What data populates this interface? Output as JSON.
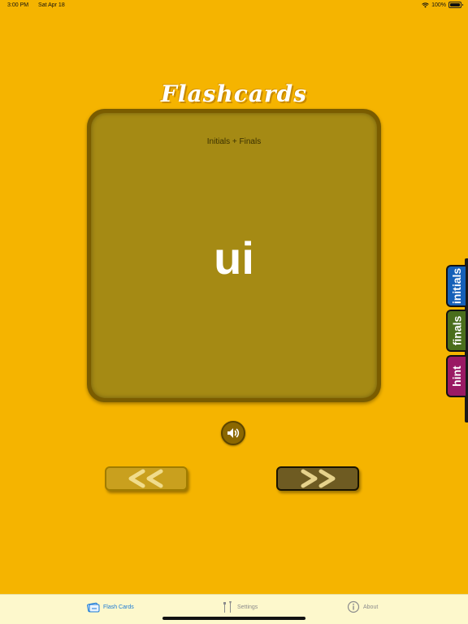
{
  "status_bar": {
    "time": "3:00 PM",
    "date": "Sat Apr 18",
    "battery": "100%"
  },
  "title": "Flashcards",
  "card": {
    "category": "Initials + Finals",
    "word": "ui"
  },
  "side_tabs": {
    "initials": "initials",
    "finals": "finals",
    "hint": "hint"
  },
  "tab_bar": {
    "items": [
      {
        "label": "Flash Cards",
        "icon": "flashcards-icon",
        "active": true
      },
      {
        "label": "Settings",
        "icon": "tools-icon",
        "active": false
      },
      {
        "label": "About",
        "icon": "info-icon",
        "active": false
      }
    ]
  },
  "colors": {
    "background": "#f5b400",
    "card_frame": "#7a5c00",
    "card_face": "#a58a14",
    "tab_initials": "#1560b8",
    "tab_finals": "#4a6e1c",
    "tab_hint": "#9a1a64",
    "tab_active": "#1a7ad6"
  }
}
